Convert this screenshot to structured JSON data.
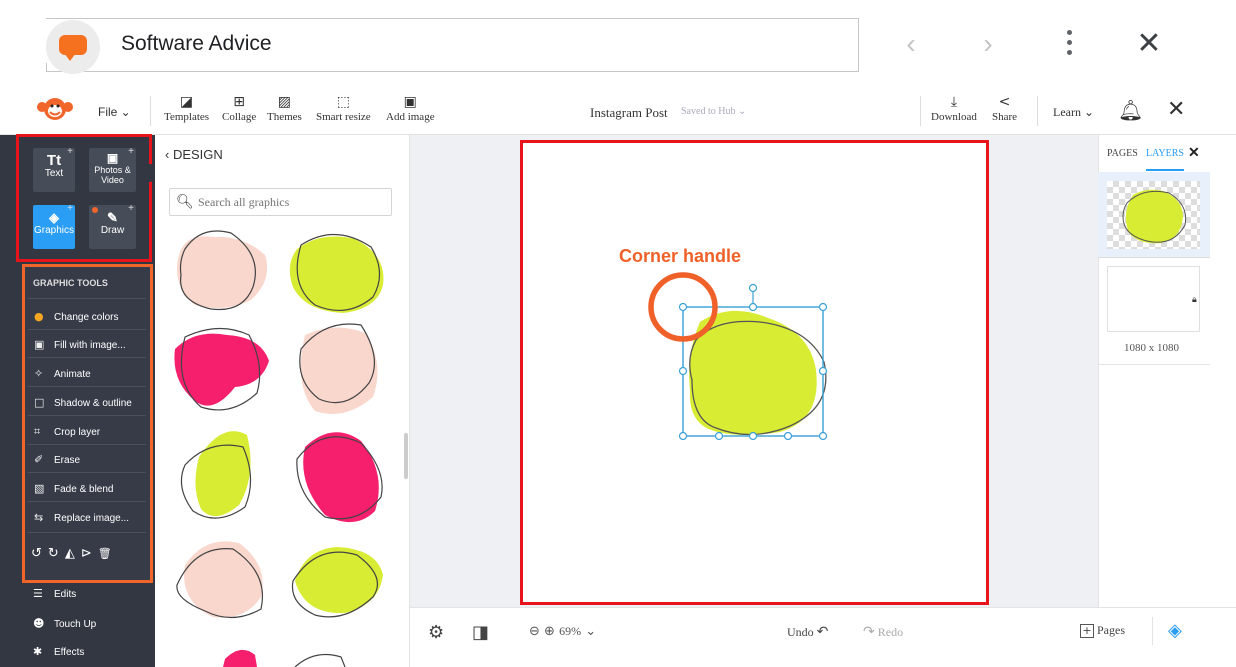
{
  "browser": {
    "site_name": "Software Advice",
    "back_icon": "chevron-left-icon",
    "forward_icon": "chevron-right-icon",
    "menu_icon": "kebab-icon",
    "close_icon": "close-icon",
    "brand_color": "#f5711f"
  },
  "app_header": {
    "file_label": "File ⌄",
    "tools": [
      {
        "label": "Templates",
        "icon": "templates-icon"
      },
      {
        "label": "Collage",
        "icon": "collage-icon"
      },
      {
        "label": "Themes",
        "icon": "themes-icon"
      },
      {
        "label": "Smart resize",
        "icon": "smart-resize-icon"
      },
      {
        "label": "Add image",
        "icon": "add-image-icon"
      }
    ],
    "doc_title": "Instagram Post",
    "doc_status": "Saved to Hub ⌄",
    "download_label": "Download",
    "share_label": "Share",
    "learn_label": "Learn ⌄"
  },
  "sidebar": {
    "tiles": [
      {
        "glyph": "Tt",
        "label": "Text"
      },
      {
        "glyph": "▣",
        "label": "Photos & Video"
      },
      {
        "glyph": "◈",
        "label": "Graphics",
        "active": true
      },
      {
        "glyph": "✎",
        "label": "Draw"
      }
    ],
    "graphic_tools_title": "GRAPHIC TOOLS",
    "graphic_tools": [
      {
        "label": "Change colors",
        "icon": "color-wheel-icon"
      },
      {
        "label": "Fill with image...",
        "icon": "fill-image-icon"
      },
      {
        "label": "Animate",
        "icon": "animate-icon"
      },
      {
        "label": "Shadow & outline",
        "icon": "shadow-icon"
      },
      {
        "label": "Crop layer",
        "icon": "crop-icon"
      },
      {
        "label": "Erase",
        "icon": "eraser-icon"
      },
      {
        "label": "Fade & blend",
        "icon": "fade-icon"
      },
      {
        "label": "Replace image...",
        "icon": "replace-icon"
      }
    ],
    "action_icons": [
      "rotate-left-icon",
      "rotate-right-icon",
      "flip-vertical-icon",
      "flip-horizontal-icon",
      "trash-icon"
    ],
    "more_items": [
      {
        "label": "Edits",
        "icon": "sliders-icon"
      },
      {
        "label": "Touch Up",
        "icon": "face-icon"
      },
      {
        "label": "Effects",
        "icon": "wand-icon"
      }
    ],
    "active_color": "#2a9df4",
    "highlight_red": "#e8141b",
    "highlight_orange": "#f1652a"
  },
  "design_panel": {
    "back_label": "‹ DESIGN",
    "search_placeholder": "Search all graphics",
    "colors": {
      "pink": "#f9d7cd",
      "lime": "#d8ec34",
      "magenta": "#f51f6d"
    }
  },
  "canvas": {
    "annotation_label": "Corner handle",
    "annotation_color": "#ef6129",
    "selection_color": "#3aa0d4",
    "shape_color": "#d8ec34"
  },
  "bottom_bar": {
    "zoom_value": "69%",
    "undo_label": "Undo",
    "redo_label": "Redo",
    "pages_label": "Pages"
  },
  "right_panel": {
    "tab_pages": "PAGES",
    "tab_layers": "LAYERS",
    "page_size": "1080 x 1080"
  }
}
